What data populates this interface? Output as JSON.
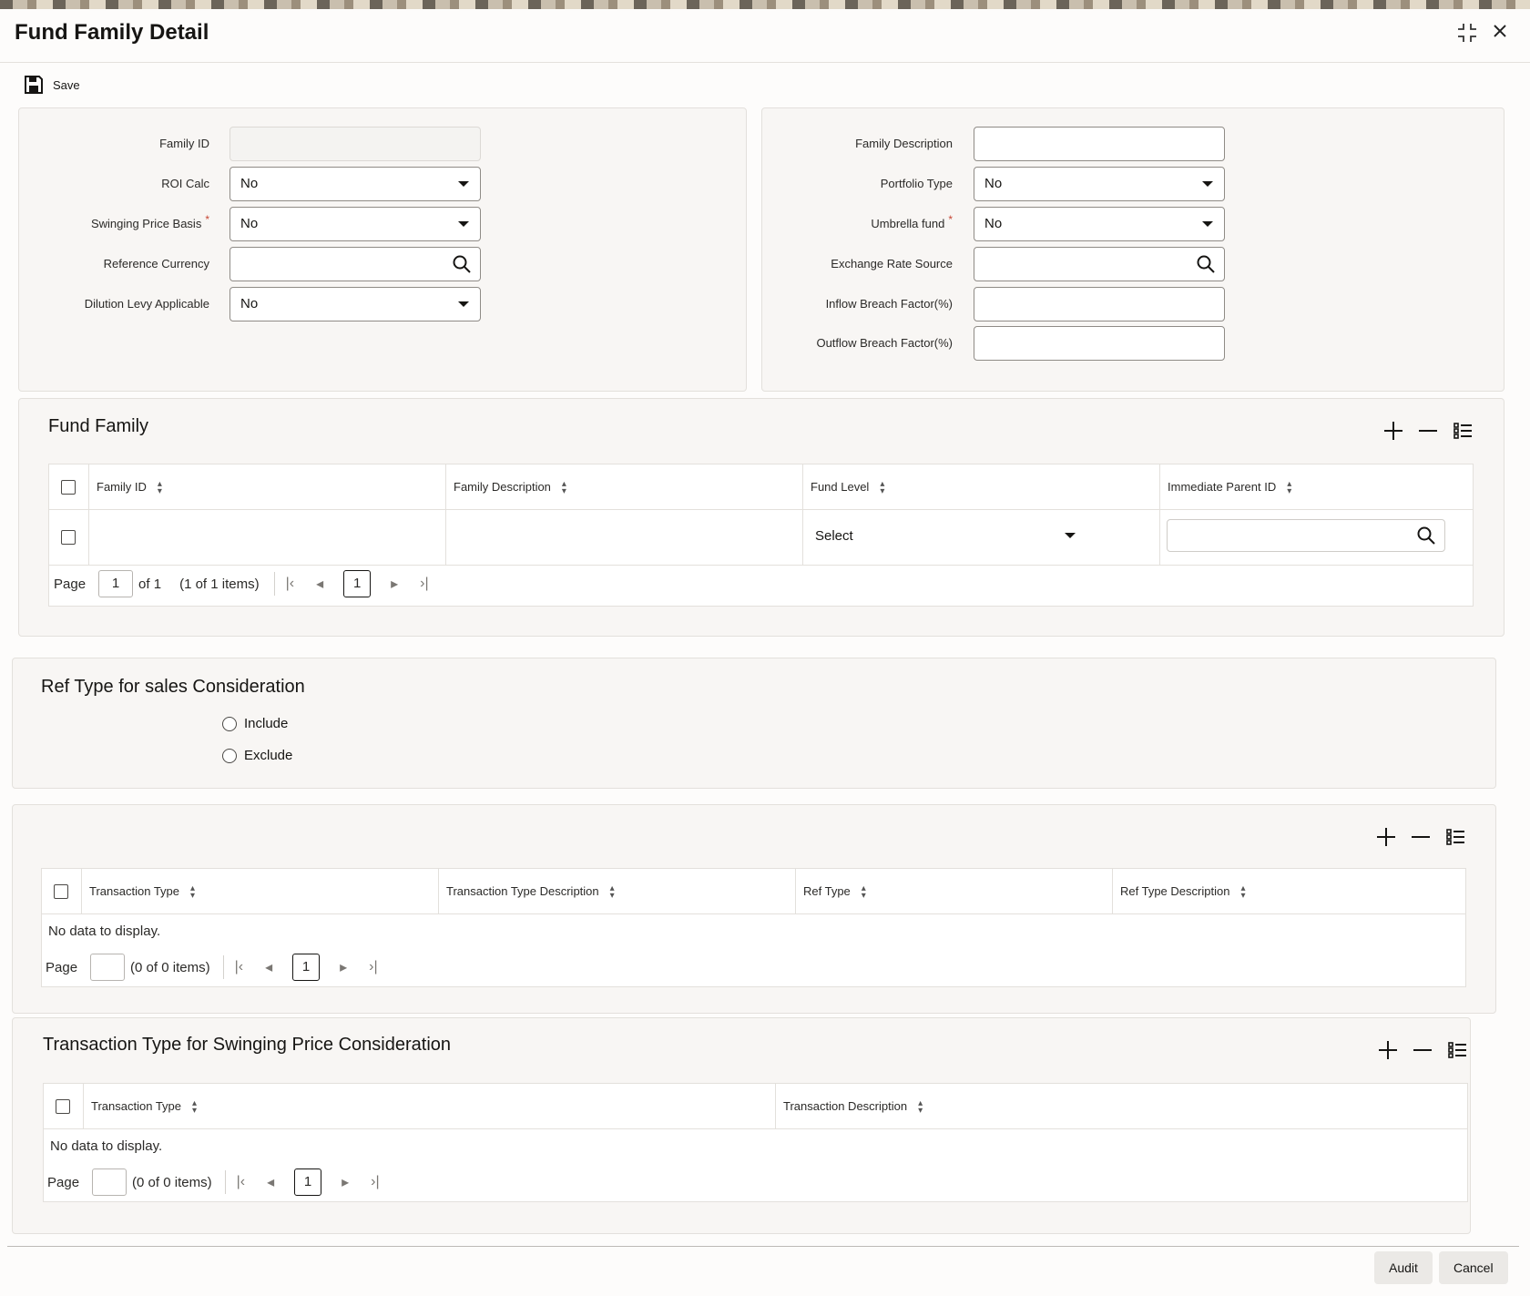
{
  "window": {
    "title": "Fund Family Detail",
    "minimize_icon": "collapse-icon",
    "close_icon": "close-icon"
  },
  "toolbar": {
    "save_label": "Save"
  },
  "form": {
    "left": [
      {
        "label": "Family ID",
        "value": "",
        "type": "readonly"
      },
      {
        "label": "ROI Calc",
        "value": "No",
        "type": "select"
      },
      {
        "label": "Swinging Price Basis",
        "value": "No",
        "type": "select",
        "required": "*"
      },
      {
        "label": "Reference Currency",
        "value": "",
        "type": "lookup"
      },
      {
        "label": "Dilution Levy Applicable",
        "value": "No",
        "type": "select"
      }
    ],
    "right": [
      {
        "label": "Family Description",
        "value": "",
        "type": "text"
      },
      {
        "label": "Portfolio Type",
        "value": "No",
        "type": "select"
      },
      {
        "label": "Umbrella fund",
        "value": "No",
        "type": "select",
        "required": "*"
      },
      {
        "label": "Exchange Rate Source",
        "value": "",
        "type": "lookup"
      },
      {
        "label": "Inflow Breach Factor(%)",
        "value": "",
        "type": "text"
      },
      {
        "label": "Outflow Breach Factor(%)",
        "value": "",
        "type": "text"
      }
    ]
  },
  "fund_family": {
    "title": "Fund Family",
    "columns": [
      "Family ID",
      "Family Description",
      "Fund Level",
      "Immediate Parent ID"
    ],
    "row": {
      "fund_level": "Select"
    },
    "pager": {
      "label": "Page",
      "page": "1",
      "of": "of 1",
      "items": "(1 of 1 items)",
      "current": "1"
    }
  },
  "ref_type": {
    "title": "Ref Type for sales Consideration",
    "options": [
      "Include",
      "Exclude"
    ]
  },
  "ref_grid": {
    "columns": [
      "Transaction Type",
      "Transaction Type Description",
      "Ref Type",
      "Ref Type Description"
    ],
    "no_data": "No data to display.",
    "pager": {
      "label": "Page",
      "page": "",
      "items": "(0 of 0 items)",
      "current": "1"
    }
  },
  "swing": {
    "title": "Transaction Type for Swinging Price Consideration",
    "columns": [
      "Transaction Type",
      "Transaction Description"
    ],
    "no_data": "No data to display.",
    "pager": {
      "label": "Page",
      "page": "",
      "items": "(0 of 0 items)",
      "current": "1"
    }
  },
  "footer": {
    "audit_label": "Audit",
    "cancel_label": "Cancel"
  }
}
